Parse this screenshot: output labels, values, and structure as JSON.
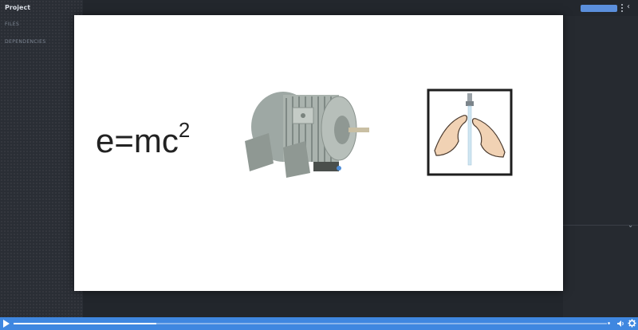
{
  "sidebar": {
    "title": "Project",
    "sections": [
      "FILES",
      "DEPENDENCIES"
    ]
  },
  "toolbar": {
    "primary_button_label": "",
    "menu_icon": "kebab-icon",
    "collapse_icon": "chevron-left-icon"
  },
  "slide": {
    "equation_base": "e=mc",
    "equation_exponent": "2",
    "images": [
      "electric-motor-image",
      "hand-washing-pictogram"
    ]
  },
  "player": {
    "play_icon": "play-icon",
    "progress_fraction": 0.24,
    "volume_icon": "volume-icon",
    "settings_icon": "settings-gear-icon"
  },
  "colors": {
    "accent": "#3f87e0",
    "background": "#22262c",
    "sidebar": "#2a2e35",
    "slide": "#ffffff"
  }
}
